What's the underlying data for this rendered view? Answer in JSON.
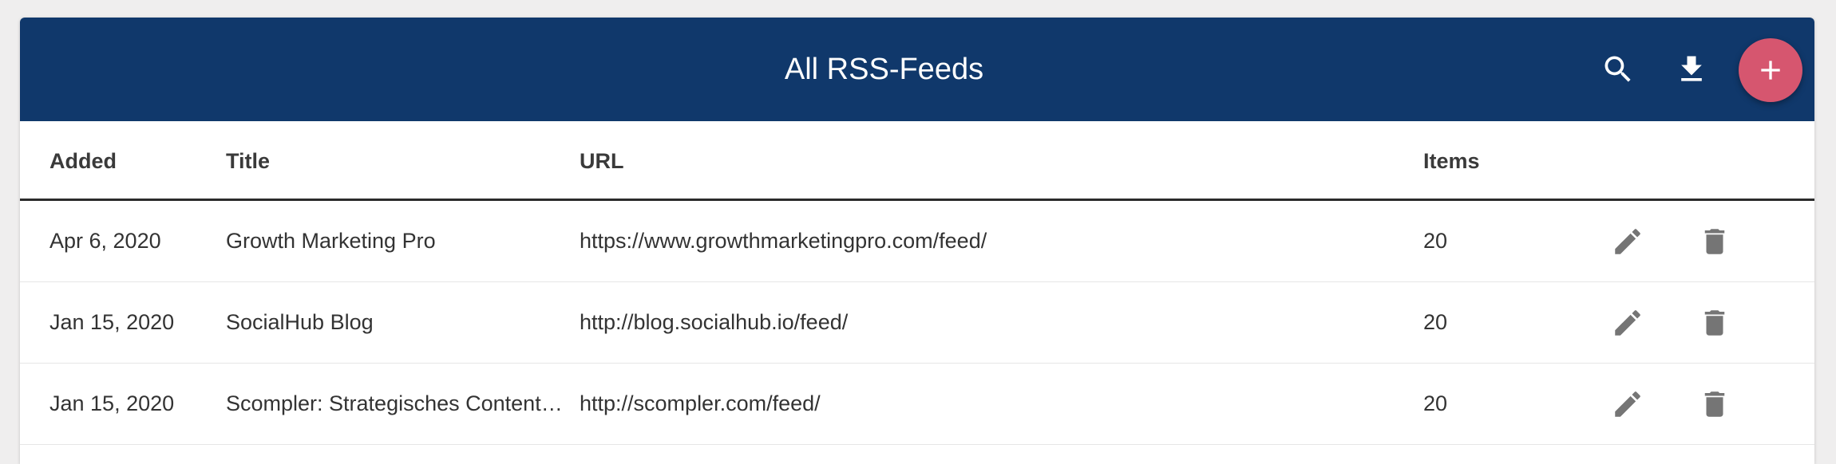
{
  "header": {
    "title": "All RSS-Feeds",
    "background_color": "#10386b",
    "icons": [
      "search-icon",
      "download-icon"
    ],
    "fab_icon": "plus-icon",
    "fab_color": "#d6566f"
  },
  "table": {
    "columns": [
      "Added",
      "Title",
      "URL",
      "Items"
    ],
    "rows": [
      {
        "added": "Apr 6, 2020",
        "title": "Growth Marketing Pro",
        "url": "https://www.growthmarketingpro.com/feed/",
        "items": "20"
      },
      {
        "added": "Jan 15, 2020",
        "title": "SocialHub Blog",
        "url": "http://blog.socialhub.io/feed/",
        "items": "20"
      },
      {
        "added": "Jan 15, 2020",
        "title": "Scompler: Strategisches Content…",
        "url": "http://scompler.com/feed/",
        "items": "20"
      }
    ],
    "row_actions": [
      "pencil-icon",
      "trash-icon"
    ]
  }
}
